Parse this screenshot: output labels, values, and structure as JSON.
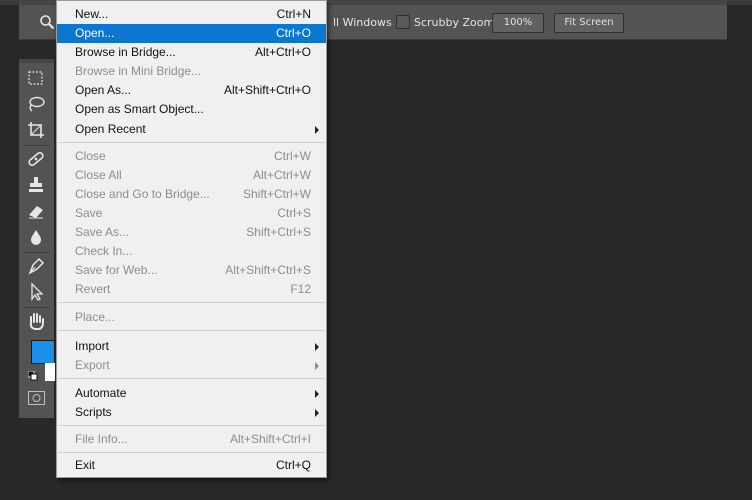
{
  "options_bar": {
    "all_windows_label": "ll Windows",
    "scrubby_zoom_label": "Scrubby Zoom",
    "zoom_100_label": "100%",
    "fit_screen_label": "Fit Screen"
  },
  "colors": {
    "foreground": "#1b90e8",
    "background": "#ffffff",
    "highlight": "#0c76d0"
  },
  "menu": {
    "items": [
      {
        "label": "New...",
        "shortcut": "Ctrl+N"
      },
      {
        "label": "Open...",
        "shortcut": "Ctrl+O"
      },
      {
        "label": "Browse in Bridge...",
        "shortcut": "Alt+Ctrl+O"
      },
      {
        "label": "Browse in Mini Bridge...",
        "shortcut": ""
      },
      {
        "label": "Open As...",
        "shortcut": "Alt+Shift+Ctrl+O"
      },
      {
        "label": "Open as Smart Object...",
        "shortcut": ""
      },
      {
        "label": "Open Recent",
        "shortcut": ""
      },
      {
        "label": "Close",
        "shortcut": "Ctrl+W"
      },
      {
        "label": "Close All",
        "shortcut": "Alt+Ctrl+W"
      },
      {
        "label": "Close and Go to Bridge...",
        "shortcut": "Shift+Ctrl+W"
      },
      {
        "label": "Save",
        "shortcut": "Ctrl+S"
      },
      {
        "label": "Save As...",
        "shortcut": "Shift+Ctrl+S"
      },
      {
        "label": "Check In...",
        "shortcut": ""
      },
      {
        "label": "Save for Web...",
        "shortcut": "Alt+Shift+Ctrl+S"
      },
      {
        "label": "Revert",
        "shortcut": "F12"
      },
      {
        "label": "Place...",
        "shortcut": ""
      },
      {
        "label": "Import",
        "shortcut": ""
      },
      {
        "label": "Export",
        "shortcut": ""
      },
      {
        "label": "Automate",
        "shortcut": ""
      },
      {
        "label": "Scripts",
        "shortcut": ""
      },
      {
        "label": "File Info...",
        "shortcut": "Alt+Shift+Ctrl+I"
      },
      {
        "label": "Exit",
        "shortcut": "Ctrl+Q"
      }
    ]
  }
}
